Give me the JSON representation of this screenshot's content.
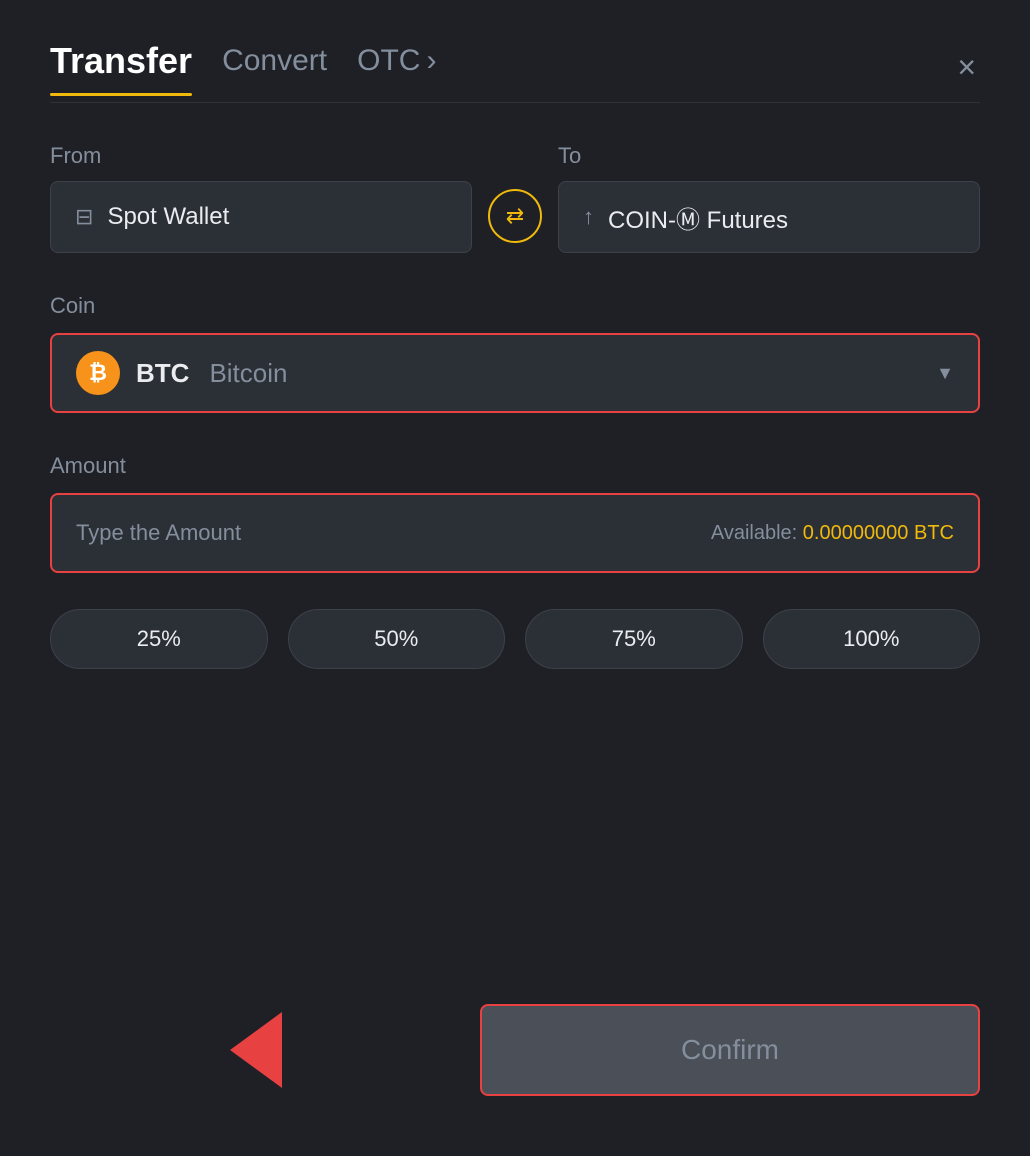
{
  "header": {
    "title": "Transfer",
    "tab_convert": "Convert",
    "tab_otc": "OTC",
    "tab_otc_chevron": "›",
    "close_label": "×"
  },
  "from": {
    "label": "From",
    "wallet_icon": "▬",
    "wallet_label": "Spot Wallet"
  },
  "swap": {
    "icon": "⇄"
  },
  "to": {
    "label": "To",
    "wallet_icon": "↑",
    "wallet_label": "COIN-Ⓜ Futures"
  },
  "coin": {
    "section_label": "Coin",
    "symbol": "BTC",
    "full_name": "Bitcoin",
    "icon_letter": "₿"
  },
  "amount": {
    "section_label": "Amount",
    "placeholder": "Type the Amount",
    "available_label": "Available:",
    "available_value": "0.00000000 BTC"
  },
  "percentages": [
    "25%",
    "50%",
    "75%",
    "100%"
  ],
  "confirm_button": "Confirm"
}
